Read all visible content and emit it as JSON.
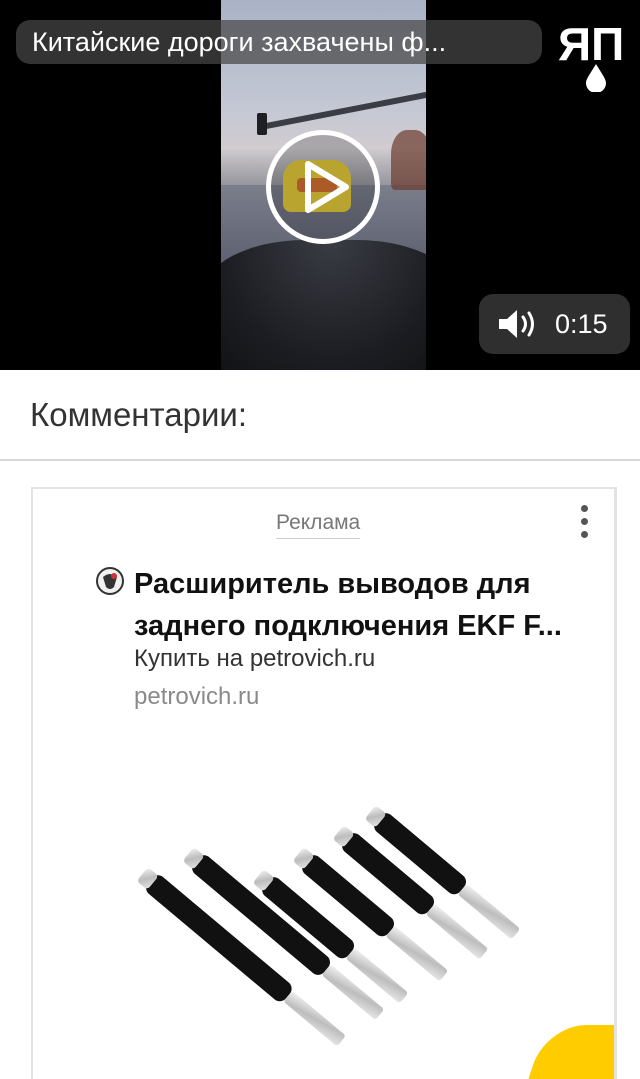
{
  "video": {
    "title": "Китайские дороги захвачены ф...",
    "logo_text": "ЯП",
    "duration": "0:15",
    "icons": {
      "play": "play-icon",
      "volume": "volume-icon",
      "logo": "yap-logo"
    }
  },
  "comments": {
    "title": "Комментарии:"
  },
  "ad": {
    "label": "Реклама",
    "title": "Расширитель выводов для заднего подключения EKF F...",
    "subtitle": "Купить на petrovich.ru",
    "domain": "petrovich.ru",
    "icons": {
      "menu": "more-vertical-icon",
      "favicon": "petrovich-favicon"
    },
    "image_subject": "product-photo-pin-extenders",
    "accent_color": "#ffcc00"
  }
}
